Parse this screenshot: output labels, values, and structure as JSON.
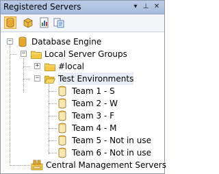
{
  "window": {
    "title": "Registered Servers",
    "pin_glyph": "⊥",
    "close_glyph": "✕",
    "dropdown_glyph": "▾"
  },
  "toolbar": {
    "buttons": [
      {
        "icon": "database-engine-icon",
        "active": true
      },
      {
        "icon": "analysis-services-icon",
        "active": false
      },
      {
        "icon": "reporting-services-icon",
        "active": false
      },
      {
        "icon": "integration-services-icon",
        "active": false
      }
    ]
  },
  "tree": {
    "root": {
      "label": "Database Engine",
      "expander": "−"
    },
    "local_server_groups": {
      "label": "Local Server Groups",
      "expander": "−"
    },
    "local": {
      "label": "#local",
      "expander": "+"
    },
    "test_environments": {
      "label": "Test Environments",
      "expander": "−"
    },
    "servers": [
      {
        "label": "Team 1 - S"
      },
      {
        "label": "Team 2 - W"
      },
      {
        "label": "Team 3 - F"
      },
      {
        "label": "Team 4 - M"
      },
      {
        "label": "Team 5 - Not in use"
      },
      {
        "label": "Team 6 - Not in use"
      }
    ],
    "central_management": {
      "label": "Central Management Servers"
    }
  },
  "colors": {
    "titlebar": "#b9cbe6",
    "folder": "#f5c842",
    "database": "#e8b33a",
    "selection": "#e8edf5"
  }
}
